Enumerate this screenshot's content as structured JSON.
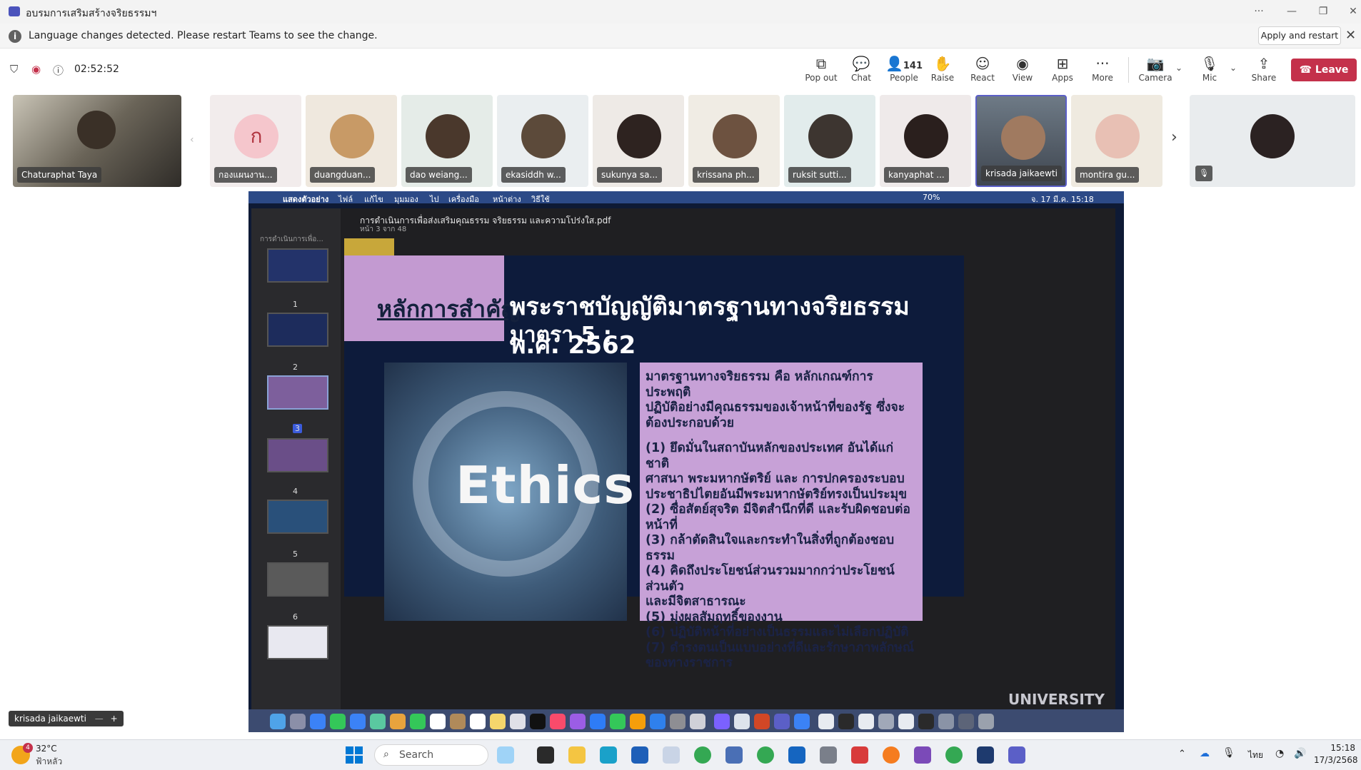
{
  "window": {
    "title": "อบรมการเสริมสร้างจริยธรรมฯ",
    "controls": [
      "...",
      "—",
      "❐",
      "✕"
    ]
  },
  "notification": {
    "message": "Language changes detected. Please restart Teams to see the change.",
    "action_label": "Apply and restart"
  },
  "meeting": {
    "timer": "02:52:52",
    "toolbar": {
      "pop_out": "Pop out",
      "chat": "Chat",
      "people": "People",
      "people_count": "141",
      "raise": "Raise",
      "react": "React",
      "view": "View",
      "apps": "Apps",
      "more": "More",
      "camera": "Camera",
      "mic": "Mic",
      "share": "Share",
      "leave": "Leave"
    },
    "accent_color": "#c4314b"
  },
  "participants": {
    "main": "Chaturaphat Taya",
    "tiles": [
      {
        "name": "กองแผนงาน...",
        "avatar_letter": "ก"
      },
      {
        "name": "duangduan..."
      },
      {
        "name": "dao weiang..."
      },
      {
        "name": "ekasiddh w..."
      },
      {
        "name": "sukunya sa..."
      },
      {
        "name": "krissana ph..."
      },
      {
        "name": "ruksit sutti..."
      },
      {
        "name": "kanyaphat ..."
      },
      {
        "name": "krisada jaikaewti"
      },
      {
        "name": "montira gu..."
      }
    ],
    "self_label": "krisada jaikaewti"
  },
  "shared_screen": {
    "mac_menu": {
      "app": "แสดงตัวอย่าง",
      "items": [
        "ไฟล์",
        "แก้ไข",
        "มุมมอง",
        "ไป",
        "เครื่องมือ",
        "หน้าต่าง",
        "วิธีใช้"
      ],
      "battery": "70%",
      "datetime": "จ. 17 มี.ค. 15:18"
    },
    "pdf": {
      "filename": "การดำเนินการเพื่อส่งเสริมคุณธรรม จริยธรรม และความโปร่งใส.pdf",
      "page_info": "หน้า 3 จาก 48",
      "sidebar_title": "การดำเนินการเพื่อ...",
      "thumbnails": [
        "1",
        "2",
        "3",
        "4",
        "5",
        "6"
      ]
    },
    "slide": {
      "key_label": "หลักการสำคัญ",
      "heading_line1": "พระราชบัญญัติมาตรฐานทางจริยธรรม พ.ศ. 2562",
      "heading_line2": "มาตรา 5 :",
      "image_word": "Ethics",
      "body": [
        "มาตรฐานทางจริยธรรม คือ หลักเกณฑ์การประพฤติ",
        "ปฏิบัติอย่างมีคุณธรรมของเจ้าหน้าที่ของรัฐ ซึ่งจะ",
        "ต้องประกอบด้วย",
        "",
        "(1) ยึดมั่นในสถาบันหลักของประเทศ อันได้แก่ ชาติ",
        "ศาสนา พระมหากษัตริย์ และ การปกครองระบอบ",
        "ประชาธิปไตยอันมีพระมหากษัตริย์ทรงเป็นประมุข",
        "(2) ซื่อสัตย์สุจริต มีจิตสำนึกที่ดี และรับผิดชอบต่อ",
        "หน้าที่",
        "(3) กล้าตัดสินใจและกระทำในสิ่งที่ถูกต้องชอบธรรม",
        "(4) คิดถึงประโยชน์ส่วนรวมมากกว่าประโยชน์ส่วนตัว",
        "และมีจิตสาธารณะ",
        "(5) มุ่งผลสัมฤทธิ์ของงาน",
        "(6) ปฏิบัติหน้าที่อย่างเป็นธรรมและไม่เลือกปฏิบัติ",
        "(7) ดำรงตนเป็นแบบอย่างที่ดีและรักษาภาพลักษณ์",
        "ของทางราชการ"
      ],
      "footer_text": "UNIVERSITY"
    }
  },
  "taskbar": {
    "temperature": "32°C",
    "condition": "ฟ้าหลัว",
    "badge": "4",
    "search_placeholder": "Search",
    "language": "ไทย",
    "time": "15:18",
    "date": "17/3/2568"
  }
}
